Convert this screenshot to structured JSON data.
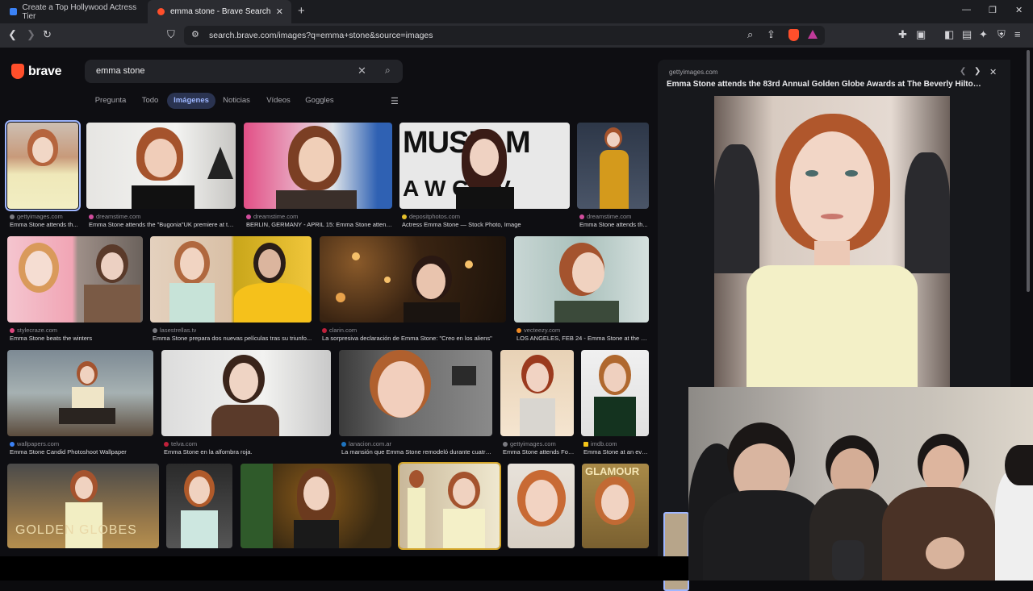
{
  "tabs": [
    {
      "title": "Create a Top Hollywood Actress Tier",
      "active": false
    },
    {
      "title": "emma stone - Brave Search",
      "active": true
    }
  ],
  "toolbar": {
    "url": "search.brave.com/images?q=emma+stone&source=images"
  },
  "brand": {
    "name": "brave",
    "color": "#ff4f2b"
  },
  "search": {
    "query": "emma stone"
  },
  "nav_tabs": [
    "Pregunta",
    "Todo",
    "Imágenes",
    "Noticias",
    "Vídeos",
    "Goggles"
  ],
  "active_nav": "Imágenes",
  "results": [
    {
      "source": "gettyimages.com",
      "caption": "Emma Stone attends th..."
    },
    {
      "source": "dreamstime.com",
      "caption": "Emma Stone attends the \"Bugonia\"UK premiere at th..."
    },
    {
      "source": "dreamstime.com",
      "caption": "BERLIN, GERMANY - APRIL 15: Emma Stone attends ..."
    },
    {
      "source": "depositphotos.com",
      "caption": "Actress Emma Stone — Stock Photo, Image"
    },
    {
      "source": "dreamstime.com",
      "caption": "Emma Stone attends th..."
    },
    {
      "source": "stylecraze.com",
      "caption": "Emma Stone beats the winters"
    },
    {
      "source": "lasestrellas.tv",
      "caption": "Emma Stone prepara dos nuevas películas tras su triunfo..."
    },
    {
      "source": "clarin.com",
      "caption": "La sorpresiva declaración de Emma Stone: \"Creo en los aliens\""
    },
    {
      "source": "vecteezy.com",
      "caption": "LOS ANGELES, FEB 24 - Emma Stone at the 10t..."
    },
    {
      "source": "wallpapers.com",
      "caption": "Emma Stone Candid Photoshoot Wallpaper"
    },
    {
      "source": "telva.com",
      "caption": "Emma Stone en la alfombra roja."
    },
    {
      "source": "lanacion.com.ar",
      "caption": "La mansión que Emma Stone remodeló durante cuatro..."
    },
    {
      "source": "gettyimages.com",
      "caption": "Emma Stone attends Foc..."
    },
    {
      "source": "imdb.com",
      "caption": "Emma Stone at an eve..."
    }
  ],
  "preview": {
    "source": "gettyimages.com",
    "title": "Emma Stone attends the 83rd Annual Golden Globe Awards at The Beverly Hilton on..."
  },
  "image_text": {
    "banner_text": "MUSIC M",
    "banner_text_2": "A W  C  A V",
    "globes_text": "GOLDEN GLOBES",
    "glamour_text": "GLAMOUR"
  },
  "icons": {
    "back": "back-arrow-icon",
    "forward": "forward-arrow-icon",
    "reload": "reload-icon",
    "bookmark": "bookmark-icon",
    "search": "search-icon",
    "close": "close-icon",
    "filter": "filter-sliders-icon"
  }
}
